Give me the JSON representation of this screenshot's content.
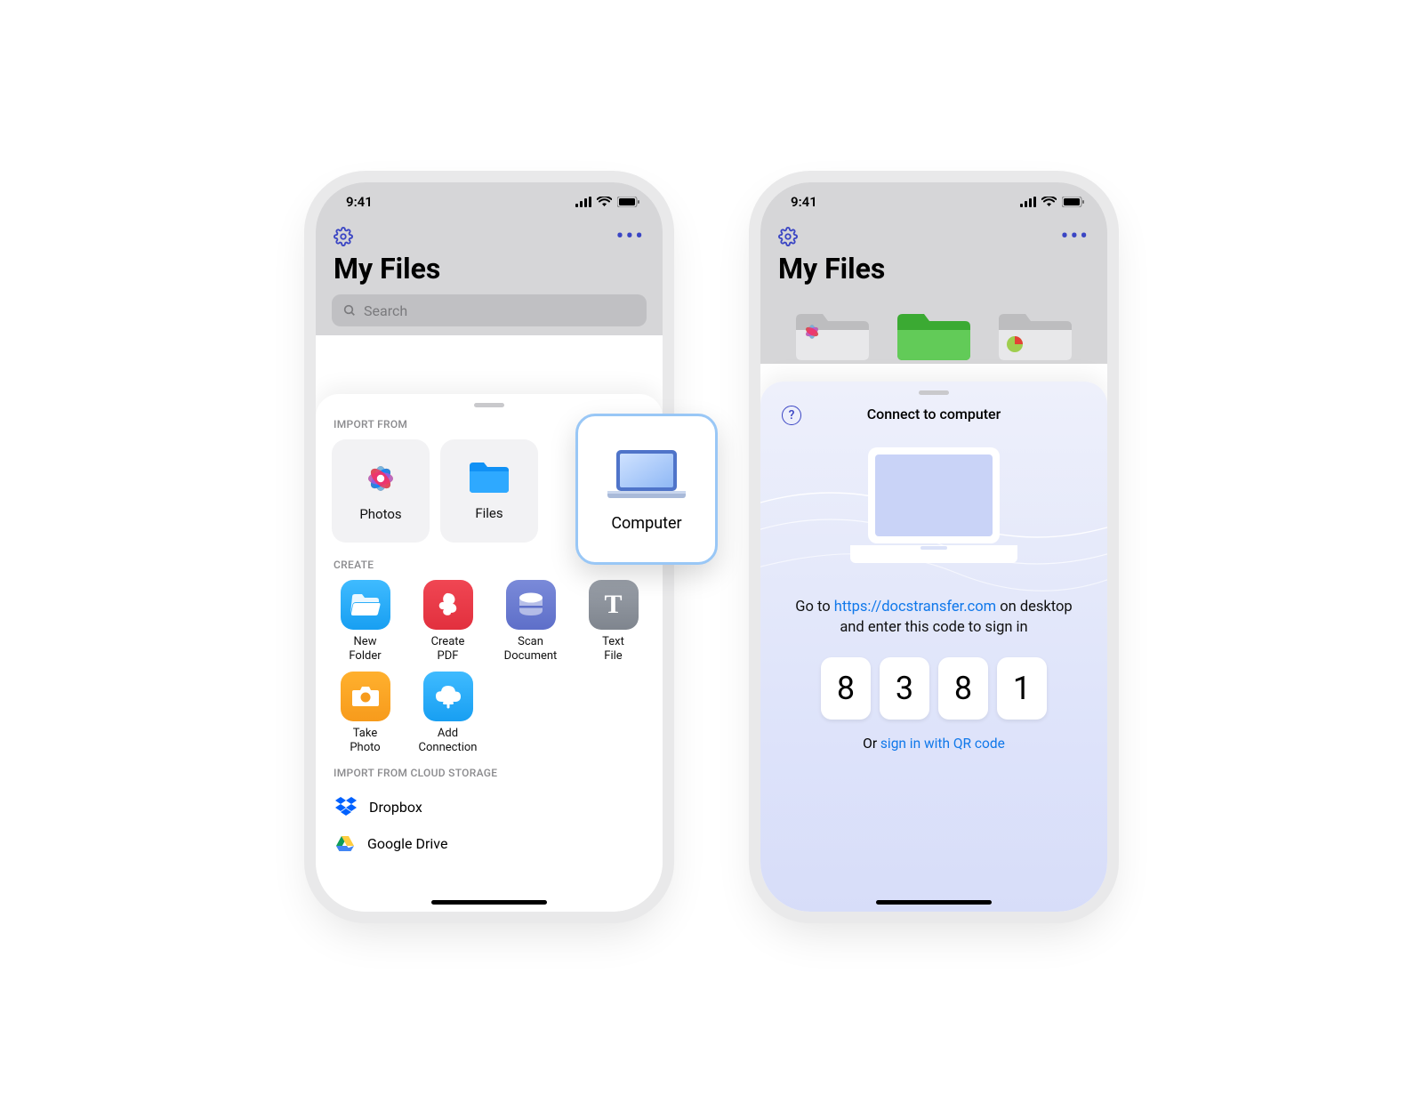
{
  "status": {
    "time": "9:41"
  },
  "header": {
    "title": "My Files",
    "search_placeholder": "Search"
  },
  "sheet1": {
    "import_label": "IMPORT FROM",
    "photos": "Photos",
    "files": "Files",
    "computer": "Computer",
    "create_label": "CREATE",
    "create_items": [
      {
        "l1": "New",
        "l2": "Folder"
      },
      {
        "l1": "Create",
        "l2": "PDF"
      },
      {
        "l1": "Scan",
        "l2": "Document"
      },
      {
        "l1": "Text",
        "l2": "File"
      },
      {
        "l1": "Take",
        "l2": "Photo"
      },
      {
        "l1": "Add",
        "l2": "Connection"
      }
    ],
    "cloud_label": "IMPORT FROM CLOUD STORAGE",
    "dropbox": "Dropbox",
    "gdrive": "Google Drive"
  },
  "sheet2": {
    "title": "Connect to computer",
    "instr_pre": "Go to ",
    "instr_url": "https://docstransfer.com",
    "instr_mid": " on desktop and enter this code to sign in",
    "code": [
      "8",
      "3",
      "8",
      "1"
    ],
    "qr_pre": "Or ",
    "qr_link": "sign in with QR code"
  }
}
